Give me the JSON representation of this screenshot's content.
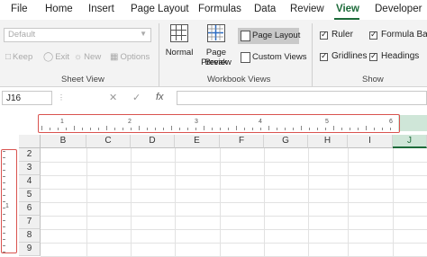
{
  "menu": {
    "tabs": [
      "File",
      "Home",
      "Insert",
      "Page Layout",
      "Formulas",
      "Data",
      "Review",
      "View",
      "Developer"
    ],
    "active": "View"
  },
  "ribbon": {
    "sheet_view": {
      "dropdown_value": "Default",
      "keep": "Keep",
      "exit": "Exit",
      "new": "New",
      "options": "Options",
      "label": "Sheet View"
    },
    "workbook_views": {
      "normal": "Normal",
      "page_break_line1": "Page Break",
      "page_break_line2": "Preview",
      "page_layout": "Page Layout",
      "custom_views": "Custom Views",
      "label": "Workbook Views"
    },
    "show": {
      "ruler": "Ruler",
      "formula_bar": "Formula Bar",
      "gridlines": "Gridlines",
      "headings": "Headings",
      "label": "Show"
    }
  },
  "formula_bar": {
    "name_box": "J16",
    "fx": "fx",
    "value": ""
  },
  "ruler": {
    "numbers": [
      "1",
      "2",
      "3",
      "4",
      "5",
      "6"
    ],
    "vertical_number": "1"
  },
  "grid": {
    "columns": [
      "B",
      "C",
      "D",
      "E",
      "F",
      "G",
      "H",
      "I",
      "J"
    ],
    "selected_column": "J",
    "rows": [
      "2",
      "3",
      "4",
      "5",
      "6",
      "7",
      "8",
      "9"
    ]
  },
  "colors": {
    "accent": "#1d6b3a",
    "highlight_box": "#d9534f"
  }
}
